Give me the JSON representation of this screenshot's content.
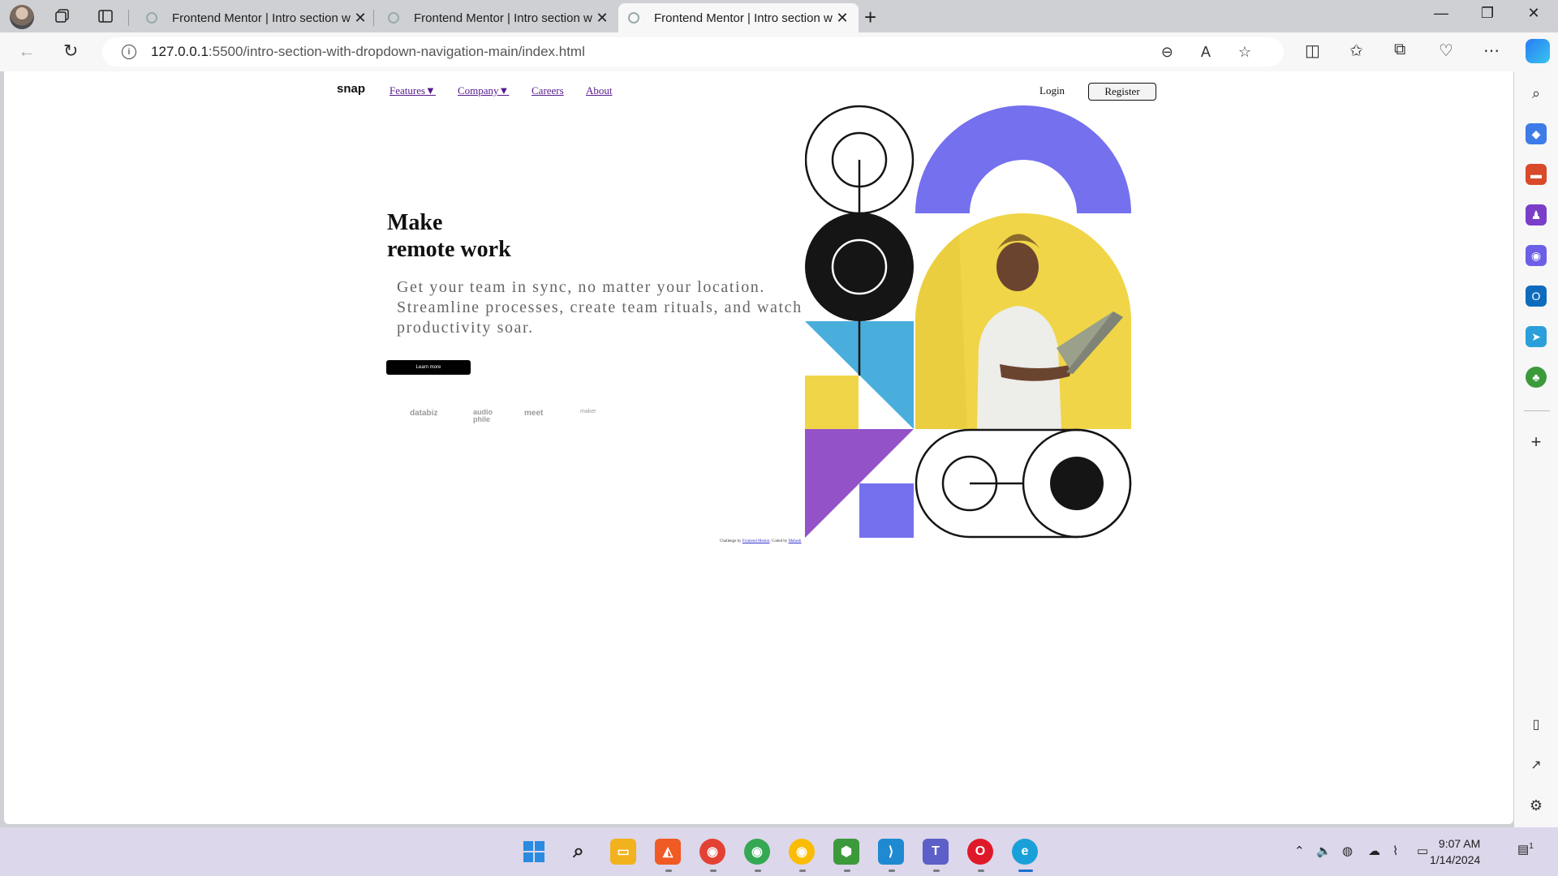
{
  "browser": {
    "tabs": [
      {
        "title": "Frontend Mentor | Intro section w",
        "active": false
      },
      {
        "title": "Frontend Mentor | Intro section w",
        "active": false
      },
      {
        "title": "Frontend Mentor | Intro section w",
        "active": true
      }
    ],
    "url_host": "127.0.0.1",
    "url_path": ":5500/intro-section-with-dropdown-navigation-main/index.html",
    "window_controls": {
      "minimize": "—",
      "restore": "❐",
      "close": "✕"
    },
    "new_tab": "+"
  },
  "site": {
    "logo": "snap",
    "nav": {
      "features": "Features▼",
      "company": "Company▼",
      "careers": "Careers",
      "about": "About",
      "login": "Login",
      "register": "Register"
    },
    "hero": {
      "headline_line1": "Make",
      "headline_line2": "remote work",
      "lead": "Get your team in sync, no matter your location. Streamline processes, create team rituals, and watch productivity soar.",
      "cta": "Learn more"
    },
    "clients": [
      "databiz",
      "audio phile",
      "meet",
      "maker"
    ],
    "attribution": {
      "prefix": "Challenge by",
      "fm_link": "Frontend Mentor",
      "mid": ". Coded by",
      "author": "Mahesh"
    },
    "colors": {
      "purple": "#7570ee",
      "yellow": "#f0d548",
      "cyan": "#4aaedc",
      "violet": "#9352c8",
      "black": "#151515"
    }
  },
  "system": {
    "time": "9:07 AM",
    "date": "1/14/2024",
    "notification_count": "1"
  }
}
